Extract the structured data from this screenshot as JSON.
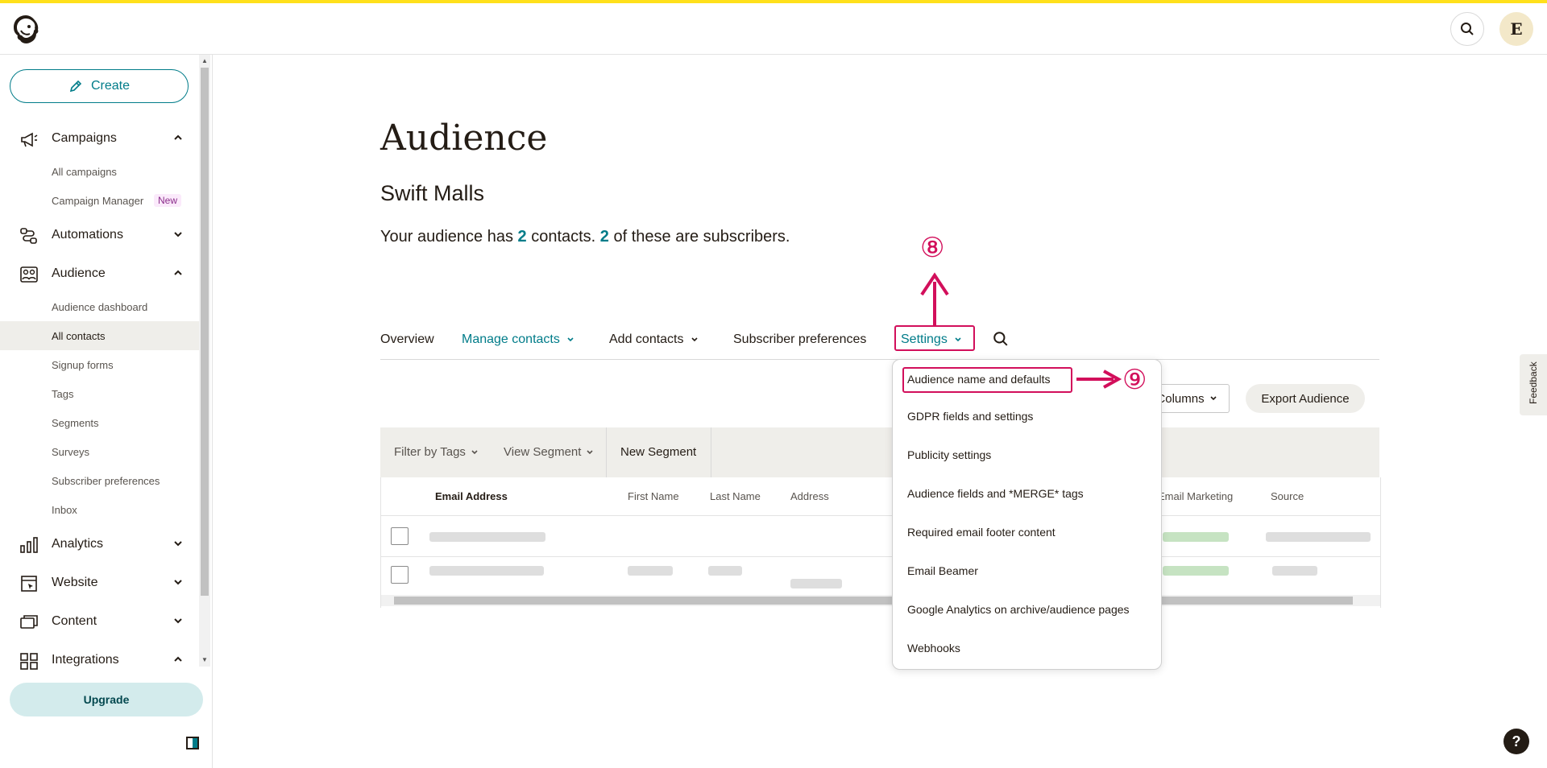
{
  "topbar": {
    "avatar_letter": "E"
  },
  "sidebar": {
    "create_label": "Create",
    "items": [
      {
        "label": "Campaigns",
        "expanded": true
      },
      {
        "label": "All campaigns"
      },
      {
        "label": "Campaign Manager",
        "badge": "New"
      },
      {
        "label": "Automations",
        "expanded": false
      },
      {
        "label": "Audience",
        "expanded": true
      },
      {
        "label": "Audience dashboard"
      },
      {
        "label": "All contacts",
        "active": true
      },
      {
        "label": "Signup forms"
      },
      {
        "label": "Tags"
      },
      {
        "label": "Segments"
      },
      {
        "label": "Surveys"
      },
      {
        "label": "Subscriber preferences"
      },
      {
        "label": "Inbox"
      },
      {
        "label": "Analytics",
        "expanded": false
      },
      {
        "label": "Website",
        "expanded": false
      },
      {
        "label": "Content",
        "expanded": false
      },
      {
        "label": "Integrations",
        "expanded": true
      }
    ],
    "upgrade_label": "Upgrade"
  },
  "main": {
    "title": "Audience",
    "audience_name": "Swift Malls",
    "summary": {
      "prefix": "Your audience has ",
      "contacts": "2",
      "middle": " contacts. ",
      "subscribers": "2",
      "suffix": " of these are subscribers."
    },
    "tabs": [
      "Overview",
      "Manage contacts",
      "Add contacts",
      "Subscriber preferences",
      "Settings"
    ],
    "columns_label": "Columns",
    "export_label": "Export Audience",
    "filter_by_tags": "Filter by Tags",
    "view_segment": "View Segment",
    "new_segment": "New Segment",
    "table_headers": [
      "Email Address",
      "First Name",
      "Last Name",
      "Address",
      "Email Marketing",
      "Source"
    ]
  },
  "settings_menu": {
    "items": [
      "Audience name and defaults",
      "GDPR fields and settings",
      "Publicity settings",
      "Audience fields and *MERGE* tags",
      "Required email footer content",
      "Email Beamer",
      "Google Analytics on archive/audience pages",
      "Webhooks"
    ]
  },
  "annotations": {
    "step8": "⑧",
    "step9": "⑨"
  },
  "feedback_label": "Feedback",
  "help_label": "?",
  "colors": {
    "accent": "#007c89",
    "brand_yellow": "#ffe01b",
    "annotation": "#d20f5b"
  }
}
